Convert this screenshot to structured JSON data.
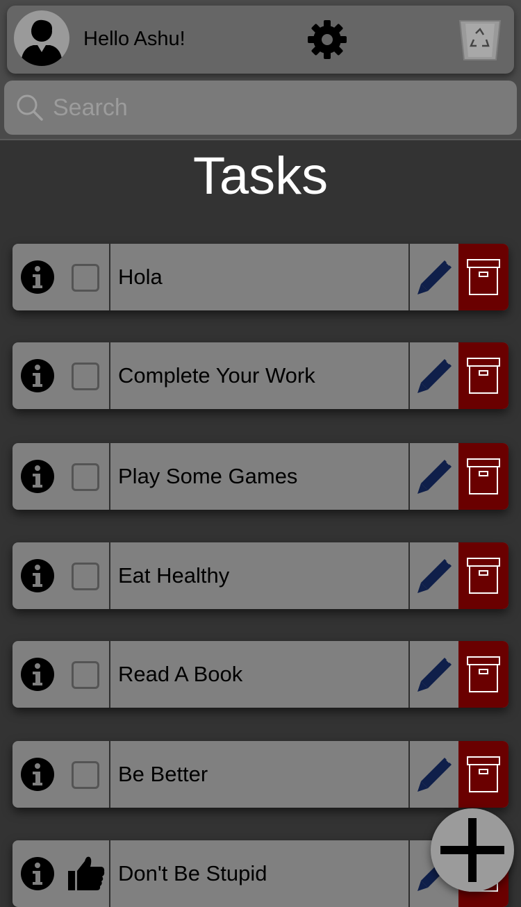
{
  "header": {
    "greeting": "Hello Ashu!",
    "avatar_icon": "user-avatar-icon",
    "settings_icon": "gear-icon",
    "trash_icon": "recycle-bin-icon"
  },
  "search": {
    "placeholder": "Search",
    "value": ""
  },
  "page_title": "Tasks",
  "tasks": [
    {
      "label": "Hola",
      "done": false
    },
    {
      "label": "Complete Your Work",
      "done": false
    },
    {
      "label": "Play Some Games",
      "done": false
    },
    {
      "label": "Eat Healthy",
      "done": false
    },
    {
      "label": "Read A Book",
      "done": false
    },
    {
      "label": "Be Better",
      "done": false
    },
    {
      "label": "Don't Be Stupid",
      "done": true
    }
  ],
  "colors": {
    "background": "#333333",
    "card": "#808080",
    "archive": "#6a0000",
    "edit_icon": "#0f1f4a",
    "title": "#ffffff"
  },
  "fab": {
    "icon": "plus-icon"
  }
}
